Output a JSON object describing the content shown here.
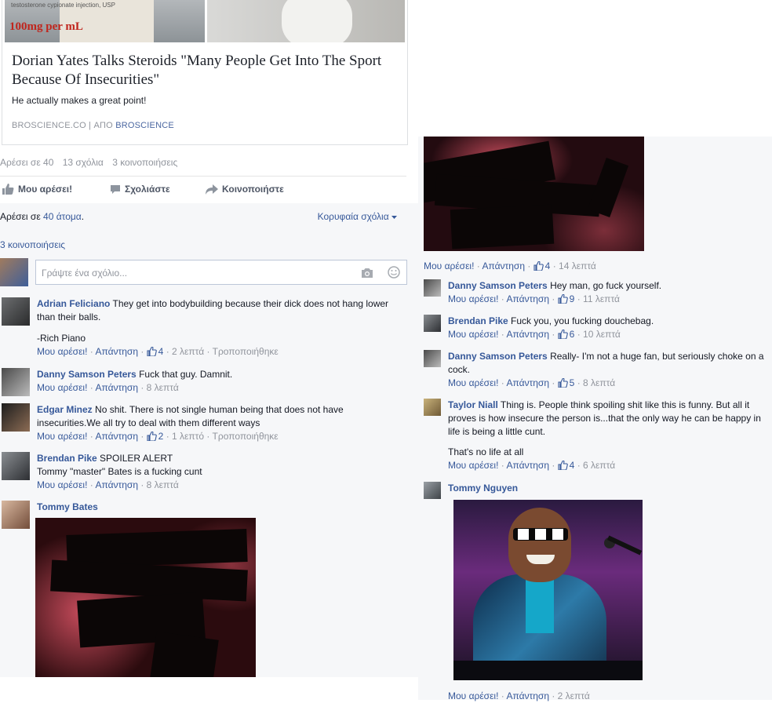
{
  "card": {
    "image_left_small": "testosterone cypionate injection, USP",
    "image_left_big": "100mg per mL",
    "title": "Dorian Yates Talks Steroids \"Many People Get Into The Sport Because Of Insecurities\"",
    "description": "He actually makes a great point!",
    "source_domain": "BROSCIENCE.CO",
    "source_sep": " | ",
    "source_prefix": "ΑΠΟ ",
    "source_name": "BROSCIENCE"
  },
  "stats": {
    "likes": "Αρέσει σε 40",
    "comments": "13 σχόλια",
    "shares": "3 κοινοποιήσεις"
  },
  "actions": {
    "like": "Μου αρέσει!",
    "comment": "Σχολιάστε",
    "share": "Κοινοποιήστε"
  },
  "likes_row": {
    "prefix": "Αρέσει σε ",
    "link": "40 άτομα",
    "suffix": ".",
    "top_comments": "Κορυφαία σχόλια"
  },
  "shares_link": "3 κοινοποιήσεις",
  "composer": {
    "placeholder": "Γράψτε ένα σχόλιο..."
  },
  "labels": {
    "like": "Μου αρέσει!",
    "reply": "Απάντηση",
    "sep": " · ",
    "edited": "Τροποποιήθηκε"
  },
  "left_comments": [
    {
      "author": "Adrian Feliciano",
      "text": "They get into bodybuilding because their dick does not hang lower than their balls.",
      "text2": "-Rich Piano",
      "likes": "4",
      "time": "2 λεπτά",
      "edited": true
    },
    {
      "author": "Danny Samson Peters",
      "text": "Fuck that guy. Damnit.",
      "time": "8 λεπτά"
    },
    {
      "author": "Edgar Minez",
      "text": "No shit. There is not single human being that does not have insecurities.We all try to deal with them different ways",
      "likes": "2",
      "time": "1 λεπτό",
      "edited": true
    },
    {
      "author": "Brendan Pike",
      "text": "SPOILER ALERT",
      "text2": "Tommy \"master\" Bates is a fucking cunt",
      "time": "8 λεπτά"
    },
    {
      "author": "Tommy Bates"
    }
  ],
  "right_top_meta": {
    "likes": "4",
    "time": "14 λεπτά"
  },
  "right_comments": [
    {
      "author": "Danny Samson Peters",
      "text": "Hey man, go fuck yourself.",
      "likes": "9",
      "time": "11 λεπτά"
    },
    {
      "author": "Brendan Pike",
      "text": "Fuck you, you fucking douchebag.",
      "likes": "6",
      "time": "10 λεπτά"
    },
    {
      "author": "Danny Samson Peters",
      "text": "Really- I'm not a huge fan, but seriously choke on a cock.",
      "likes": "5",
      "time": "8 λεπτά"
    },
    {
      "author": "Taylor Niall",
      "text": "Thing is. People think spoiling shit like this is funny. But all it proves is how insecure the person is...that the only way he can be happy in life is being a little cunt.",
      "text2": "That's no life at all",
      "likes": "4",
      "time": "6 λεπτά"
    },
    {
      "author": "Tommy Nguyen",
      "time": "2 λεπτά"
    }
  ],
  "colors": {
    "link": "#365899",
    "muted": "#90949c",
    "feed_bg": "#f6f7f9"
  }
}
